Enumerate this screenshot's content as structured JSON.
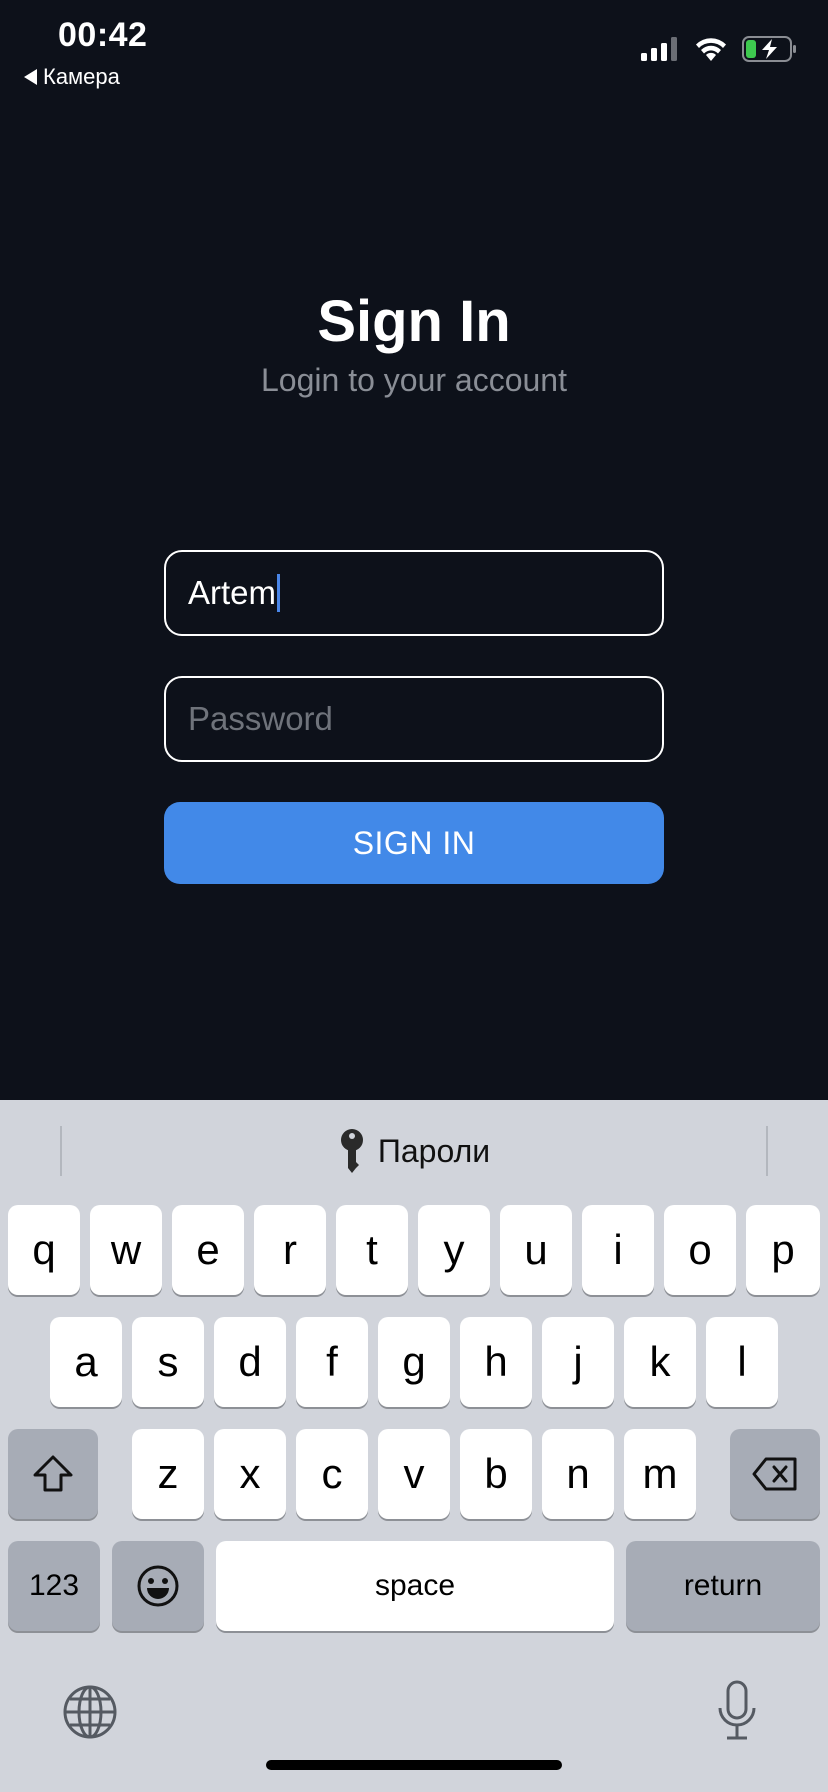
{
  "status_bar": {
    "time": "00:42",
    "back_app": "Камера",
    "icons": [
      "cellular-signal-icon",
      "wifi-icon",
      "battery-charging-icon"
    ]
  },
  "header": {
    "title": "Sign In",
    "subtitle": "Login to your account"
  },
  "form": {
    "username_value": "Artem",
    "password_placeholder": "Password",
    "submit_label": "SIGN IN"
  },
  "colors": {
    "background": "#0d111a",
    "accent": "#4289e8",
    "keyboard": "#d1d4db"
  },
  "keyboard": {
    "suggestion": "Пароли",
    "row1": [
      "q",
      "w",
      "e",
      "r",
      "t",
      "y",
      "u",
      "i",
      "o",
      "p"
    ],
    "row2": [
      "a",
      "s",
      "d",
      "f",
      "g",
      "h",
      "j",
      "k",
      "l"
    ],
    "row3": [
      "z",
      "x",
      "c",
      "v",
      "b",
      "n",
      "m"
    ],
    "numbers_label": "123",
    "space_label": "space",
    "return_label": "return"
  }
}
